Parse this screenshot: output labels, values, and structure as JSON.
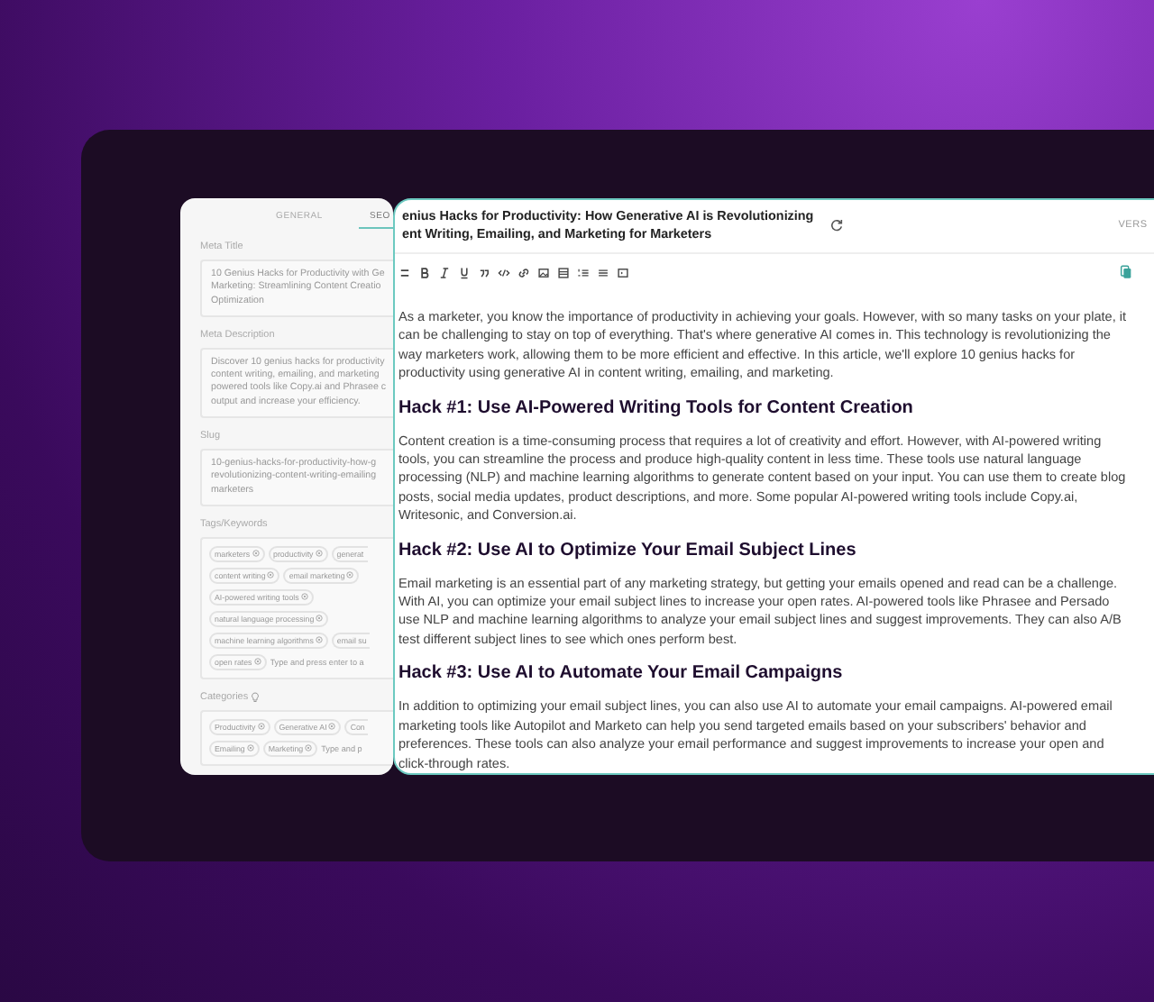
{
  "seo_panel": {
    "tabs": [
      {
        "label": "GENERAL",
        "selected": false
      },
      {
        "label": "SEO",
        "selected": true
      }
    ],
    "meta_title": {
      "label": "Meta Title",
      "lines": [
        "10 Genius Hacks for Productivity with Ge",
        "Marketing: Streamlining Content Creatio",
        "Optimization"
      ]
    },
    "meta_description": {
      "label": "Meta Description",
      "lines": [
        "Discover 10 genius hacks for productivity",
        "content writing, emailing, and marketing",
        "powered tools like Copy.ai and Phrasee c",
        "output and increase your efficiency."
      ]
    },
    "slug": {
      "label": "Slug",
      "lines": [
        "10-genius-hacks-for-productivity-how-g",
        "revolutionizing-content-writing-emailing",
        "marketers"
      ]
    },
    "tags": {
      "label": "Tags/Keywords",
      "rows": [
        [
          {
            "text": "marketers",
            "partial": false
          },
          {
            "text": "productivity",
            "partial": false
          },
          {
            "text": "generat",
            "partial": true
          }
        ],
        [
          {
            "text": "content writing",
            "partial": false
          },
          {
            "text": "email marketing",
            "partial": false
          }
        ],
        [
          {
            "text": "AI-powered writing tools",
            "partial": false
          }
        ],
        [
          {
            "text": "natural language processing",
            "partial": false
          }
        ],
        [
          {
            "text": "machine learning algorithms",
            "partial": false
          },
          {
            "text": "email su",
            "partial": true
          }
        ],
        [
          {
            "text": "open rates",
            "partial": false
          }
        ]
      ],
      "placeholder": "Type and press enter to a"
    },
    "categories": {
      "label": "Categories",
      "rows": [
        [
          {
            "text": "Productivity",
            "partial": false
          },
          {
            "text": "Generative AI",
            "partial": false
          },
          {
            "text": "Con",
            "partial": true
          }
        ],
        [
          {
            "text": "Emailing",
            "partial": false
          },
          {
            "text": "Marketing",
            "partial": false
          }
        ]
      ],
      "placeholder": "Type and p"
    }
  },
  "editor": {
    "title_lines": [
      "enius Hacks for Productivity: How Generative AI is Revolutionizing",
      "ent Writing, Emailing, and Marketing for Marketers"
    ],
    "version_label": "VERS",
    "blocks": [
      {
        "kind": "paragraph",
        "lines": [
          "As a marketer, you know the importance of productivity in achieving your goals. However, with so many tasks on your plate, it",
          "can be challenging to stay on top of everything. That's where generative AI comes in. This technology is revolutionizing the",
          "way marketers work, allowing them to be more efficient and effective. In this article, we'll explore 10 genius hacks for",
          "productivity using generative AI in content writing, emailing, and marketing."
        ]
      },
      {
        "kind": "heading",
        "text": "Hack #1: Use AI-Powered Writing Tools for Content Creation"
      },
      {
        "kind": "paragraph",
        "lines": [
          "Content creation is a time-consuming process that requires a lot of creativity and effort. However, with AI-powered writing",
          "tools, you can streamline the process and produce high-quality content in less time. These tools use natural language",
          "processing (NLP) and machine learning algorithms to generate content based on your input. You can use them to create blog",
          "posts, social media updates, product descriptions, and more. Some popular AI-powered writing tools include Copy.ai,",
          "Writesonic, and Conversion.ai."
        ]
      },
      {
        "kind": "heading",
        "text": "Hack #2: Use AI to Optimize Your Email Subject Lines"
      },
      {
        "kind": "paragraph",
        "lines": [
          "Email marketing is an essential part of any marketing strategy, but getting your emails opened and read can be a challenge.",
          "With AI, you can optimize your email subject lines to increase your open rates. AI-powered tools like Phrasee and Persado",
          "use NLP and machine learning algorithms to analyze your email subject lines and suggest improvements. They can also A/B",
          "test different subject lines to see which ones perform best."
        ]
      },
      {
        "kind": "heading",
        "text": "Hack #3: Use AI to Automate Your Email Campaigns"
      },
      {
        "kind": "paragraph",
        "lines": [
          "In addition to optimizing your email subject lines, you can also use AI to automate your email campaigns. AI-powered email",
          "marketing tools like Autopilot and Marketo can help you send targeted emails based on your subscribers' behavior and",
          "preferences. These tools can also analyze your email performance and suggest improvements to increase your open and",
          "click-through rates."
        ]
      }
    ]
  }
}
